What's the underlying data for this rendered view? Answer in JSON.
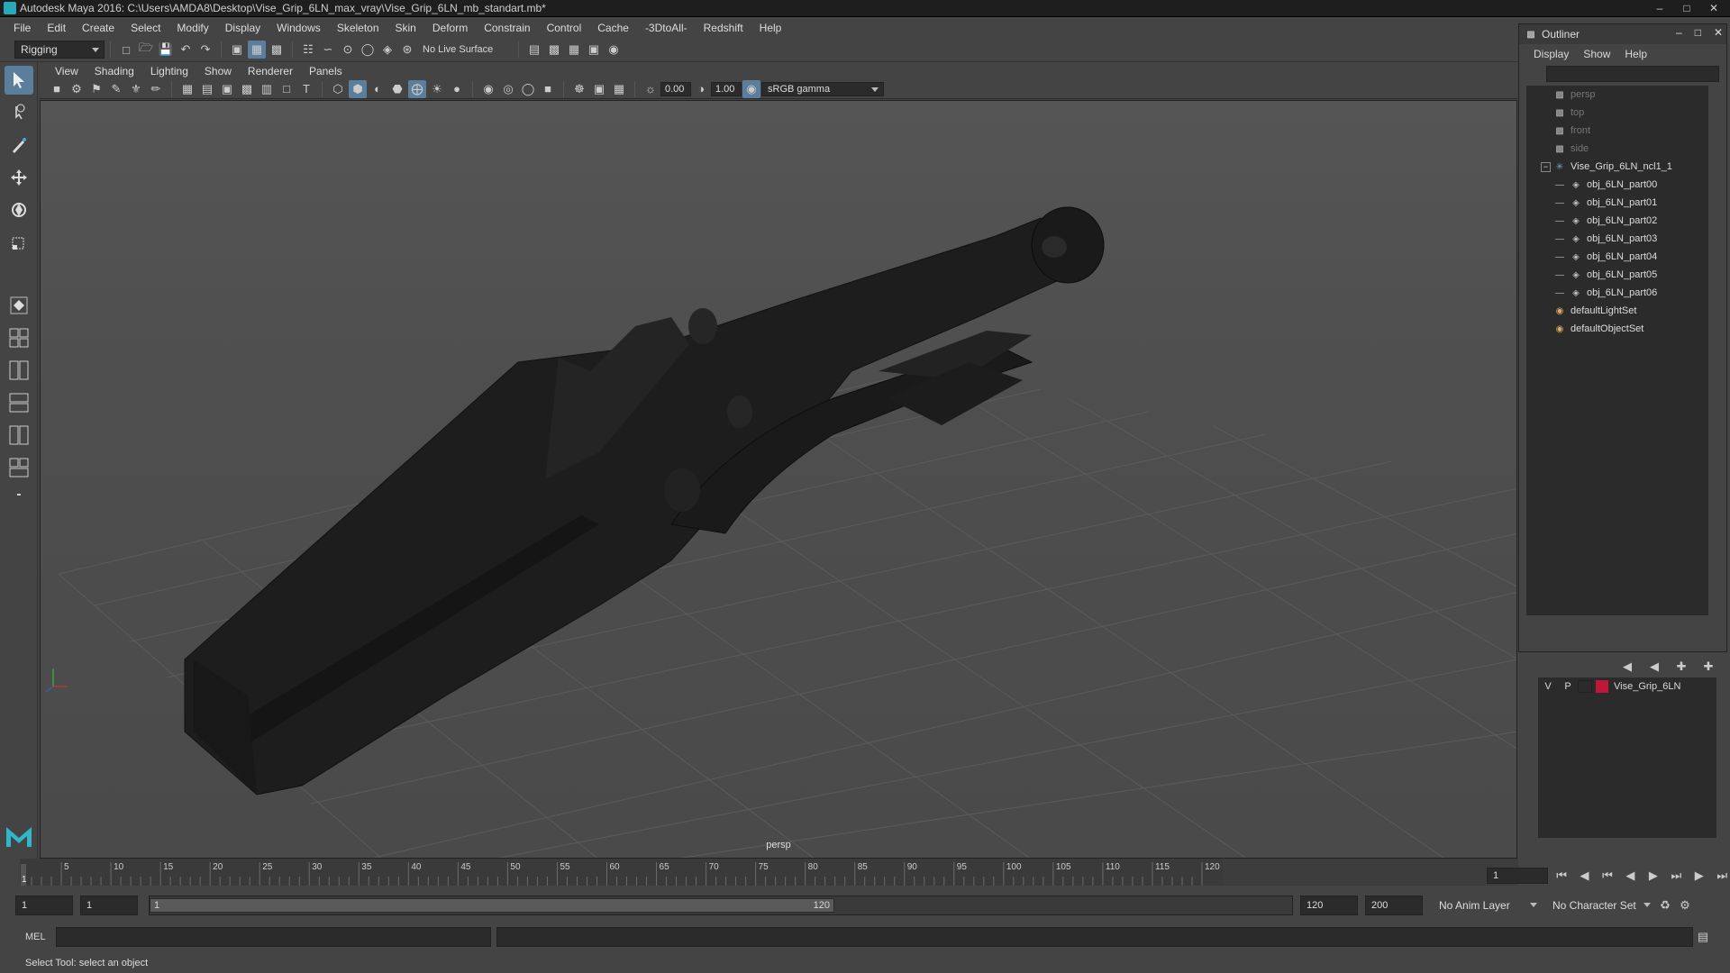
{
  "window": {
    "title": "Autodesk Maya 2016: C:\\Users\\AMDA8\\Desktop\\Vise_Grip_6LN_max_vray\\Vise_Grip_6LN_mb_standart.mb*"
  },
  "menubar": [
    "File",
    "Edit",
    "Create",
    "Select",
    "Modify",
    "Display",
    "Windows",
    "Skeleton",
    "Skin",
    "Deform",
    "Constrain",
    "Control",
    "Cache",
    "-3DtoAll-",
    "Redshift",
    "Help"
  ],
  "shelf": {
    "mode": "Rigging",
    "live_surface": "No Live Surface"
  },
  "panel_menu": [
    "View",
    "Shading",
    "Lighting",
    "Show",
    "Renderer",
    "Panels"
  ],
  "panel_toolbar": {
    "exposure": "0.00",
    "gamma": "1.00",
    "color_space": "sRGB gamma"
  },
  "viewport": {
    "camera_label": "persp"
  },
  "outliner": {
    "title": "Outliner",
    "menu": [
      "Display",
      "Show",
      "Help"
    ],
    "items": [
      {
        "label": "persp",
        "indent": 1,
        "icon": "camera-icon",
        "dim": true
      },
      {
        "label": "top",
        "indent": 1,
        "icon": "camera-icon",
        "dim": true
      },
      {
        "label": "front",
        "indent": 1,
        "icon": "camera-icon",
        "dim": true
      },
      {
        "label": "side",
        "indent": 1,
        "icon": "camera-icon",
        "dim": true
      },
      {
        "label": "Vise_Grip_6LN_ncl1_1",
        "indent": 1,
        "icon": "group-icon",
        "dim": false,
        "expander": "−"
      },
      {
        "label": "obj_6LN_part00",
        "indent": 2,
        "icon": "mesh-icon",
        "dim": false
      },
      {
        "label": "obj_6LN_part01",
        "indent": 2,
        "icon": "mesh-icon",
        "dim": false
      },
      {
        "label": "obj_6LN_part02",
        "indent": 2,
        "icon": "mesh-icon",
        "dim": false
      },
      {
        "label": "obj_6LN_part03",
        "indent": 2,
        "icon": "mesh-icon",
        "dim": false
      },
      {
        "label": "obj_6LN_part04",
        "indent": 2,
        "icon": "mesh-icon",
        "dim": false
      },
      {
        "label": "obj_6LN_part05",
        "indent": 2,
        "icon": "mesh-icon",
        "dim": false
      },
      {
        "label": "obj_6LN_part06",
        "indent": 2,
        "icon": "mesh-icon",
        "dim": false
      },
      {
        "label": "defaultLightSet",
        "indent": 1,
        "icon": "set-icon",
        "dim": false
      },
      {
        "label": "defaultObjectSet",
        "indent": 1,
        "icon": "set-icon",
        "dim": false
      }
    ]
  },
  "layers": {
    "visible": "V",
    "playback": "P",
    "layer_name": "Vise_Grip_6LN",
    "layer_color": "#c0163a"
  },
  "timeline": {
    "ticks": [
      "5",
      "10",
      "15",
      "20",
      "25",
      "30",
      "35",
      "40",
      "45",
      "50",
      "55",
      "60",
      "65",
      "70",
      "75",
      "80",
      "85",
      "90",
      "95",
      "100",
      "105",
      "110",
      "115",
      "120"
    ],
    "start_label": "1",
    "current_frame": "1"
  },
  "range": {
    "start": "1",
    "current": "1",
    "slider_start": "1",
    "slider_end": "120",
    "end": "120",
    "max": "200",
    "anim_layer": "No Anim Layer",
    "character_set": "No Character Set"
  },
  "cmd": {
    "lang": "MEL"
  },
  "help": {
    "text": "Select Tool: select an object"
  }
}
